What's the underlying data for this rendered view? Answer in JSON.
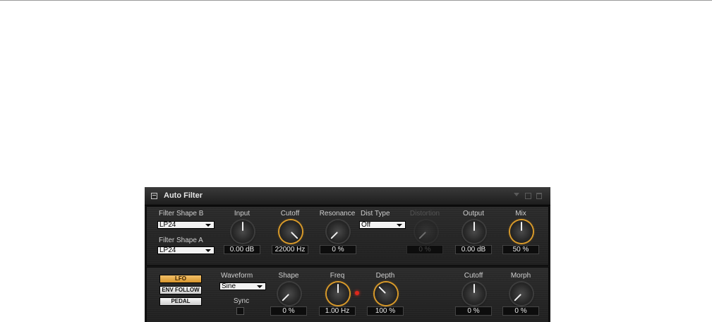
{
  "plugin": {
    "title": "Auto Filter"
  },
  "filter": {
    "shape_b": {
      "label": "Filter Shape B",
      "value": "LP24"
    },
    "shape_a": {
      "label": "Filter Shape A",
      "value": "LP24"
    },
    "input": {
      "label": "Input",
      "value": "0.00 dB"
    },
    "cutoff": {
      "label": "Cutoff",
      "value": "22000 Hz"
    },
    "resonance": {
      "label": "Resonance",
      "value": "0 %"
    },
    "dist_type": {
      "label": "Dist Type",
      "value": "Off"
    },
    "distortion": {
      "label": "Distortion",
      "value": "0 %"
    },
    "output": {
      "label": "Output",
      "value": "0.00 dB"
    },
    "mix": {
      "label": "Mix",
      "value": "50 %"
    }
  },
  "modulation": {
    "buttons": {
      "lfo": "LFO",
      "env_follow": "ENV FOLLOW",
      "pedal": "PEDAL"
    },
    "waveform": {
      "label": "Waveform",
      "value": "Sine"
    },
    "sync": {
      "label": "Sync"
    },
    "shape": {
      "label": "Shape",
      "value": "0 %"
    },
    "freq": {
      "label": "Freq",
      "value": "1.00 Hz"
    },
    "depth": {
      "label": "Depth",
      "value": "100 %"
    },
    "cutoff": {
      "label": "Cutoff",
      "value": "0 %"
    },
    "morph": {
      "label": "Morph",
      "value": "0 %"
    }
  },
  "colors": {
    "accent": "#d89a2a",
    "led": "#e0281c",
    "panel": "#242424"
  },
  "icons": [
    "plugin-menu-icon",
    "preset-dropdown-icon",
    "save-icon",
    "trash-icon"
  ]
}
